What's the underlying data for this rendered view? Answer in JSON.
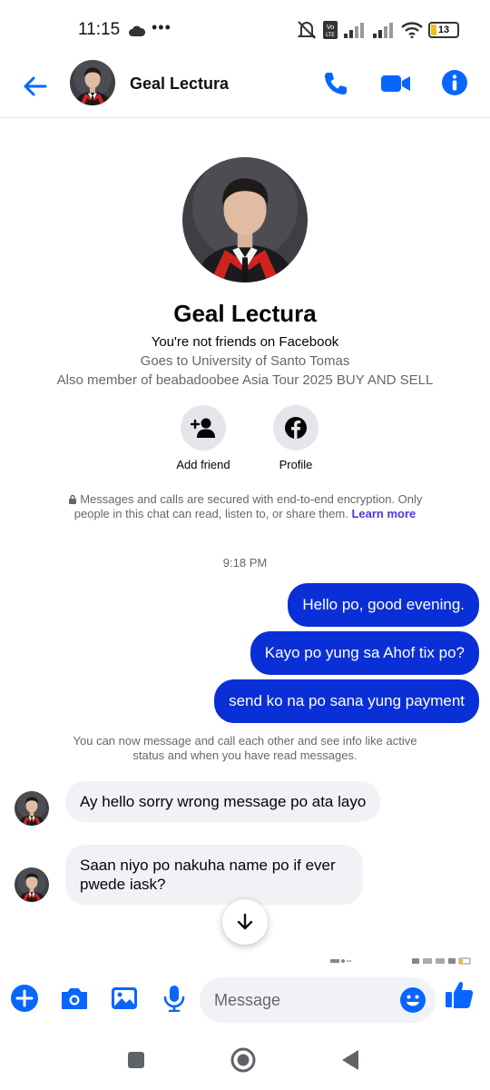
{
  "status_bar": {
    "time": "11:15",
    "dots": "•••",
    "battery": "13"
  },
  "header": {
    "contact_name": "Geal Lectura"
  },
  "profile": {
    "name": "Geal Lectura",
    "friend_status": "You're not friends on Facebook",
    "school": "Goes to University of Santo Tomas",
    "group": "Also member of beabadoobee Asia Tour 2025 BUY AND SELL",
    "actions": [
      {
        "label": "Add friend"
      },
      {
        "label": "Profile"
      }
    ]
  },
  "encryption": {
    "text": "Messages and calls are secured with end-to-end encryption. Only people in this chat can read, listen to, or share them.",
    "link": "Learn more"
  },
  "conversation": {
    "timestamp": "9:18 PM",
    "outgoing": [
      "Hello po, good evening.",
      "Kayo po yung sa Ahof tix po?",
      "send ko na po sana yung payment"
    ],
    "system_note": "You can now message and call each other and see info like active status and when you have read messages.",
    "incoming": [
      "Ay hello sorry wrong message po ata layo",
      "Saan niyo po nakuha name po if ever pwede iask?"
    ]
  },
  "composer": {
    "placeholder": "Message"
  },
  "colors": {
    "accent": "#0866ff",
    "outgoing_bubble": "#0a2fd6",
    "incoming_bubble": "#f0f2f5",
    "link": "#4a3bd6"
  },
  "icons": [
    "back-arrow-icon",
    "phone-icon",
    "video-icon",
    "info-icon",
    "add-person-icon",
    "facebook-icon",
    "lock-icon",
    "chevron-down-icon",
    "plus-icon",
    "camera-icon",
    "image-icon",
    "microphone-icon",
    "emoji-icon",
    "thumbs-up-icon"
  ]
}
